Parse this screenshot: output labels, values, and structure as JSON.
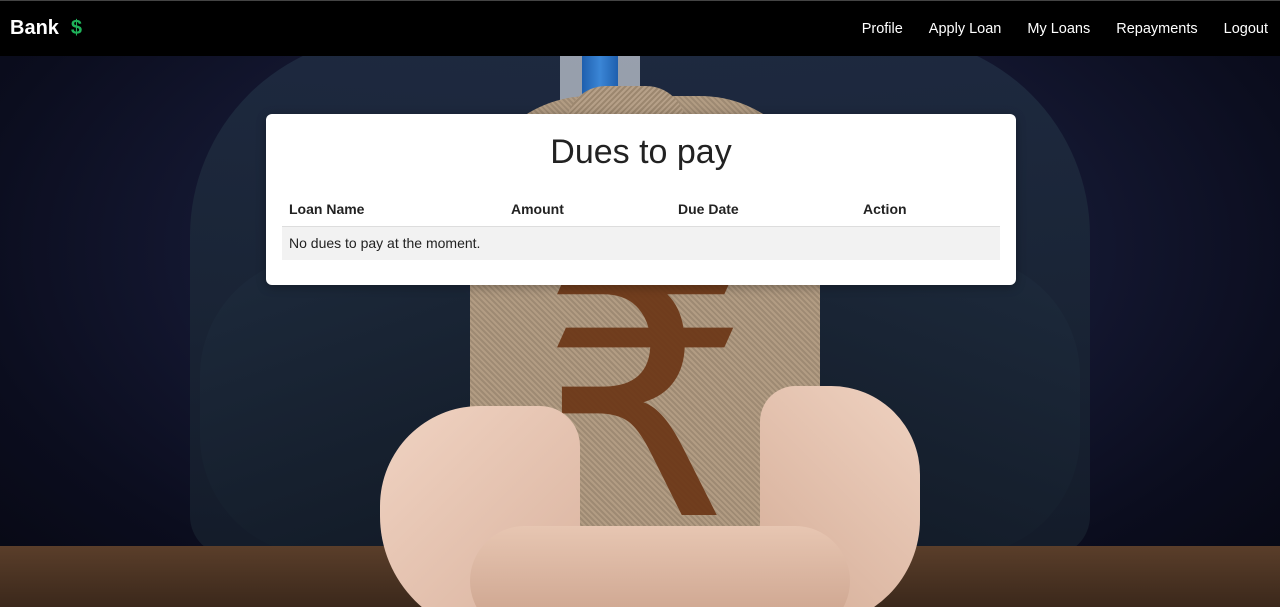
{
  "navbar": {
    "brand": "Bank",
    "brand_icon": "$",
    "links": [
      "Profile",
      "Apply Loan",
      "My Loans",
      "Repayments",
      "Logout"
    ]
  },
  "card": {
    "title": "Dues to pay",
    "columns": [
      "Loan Name",
      "Amount",
      "Due Date",
      "Action"
    ],
    "empty_message": "No dues to pay at the moment."
  },
  "colors": {
    "navbar_bg": "#000000",
    "brand_icon": "#1fb35a",
    "card_bg": "#ffffff",
    "row_bg": "#f2f2f2"
  }
}
